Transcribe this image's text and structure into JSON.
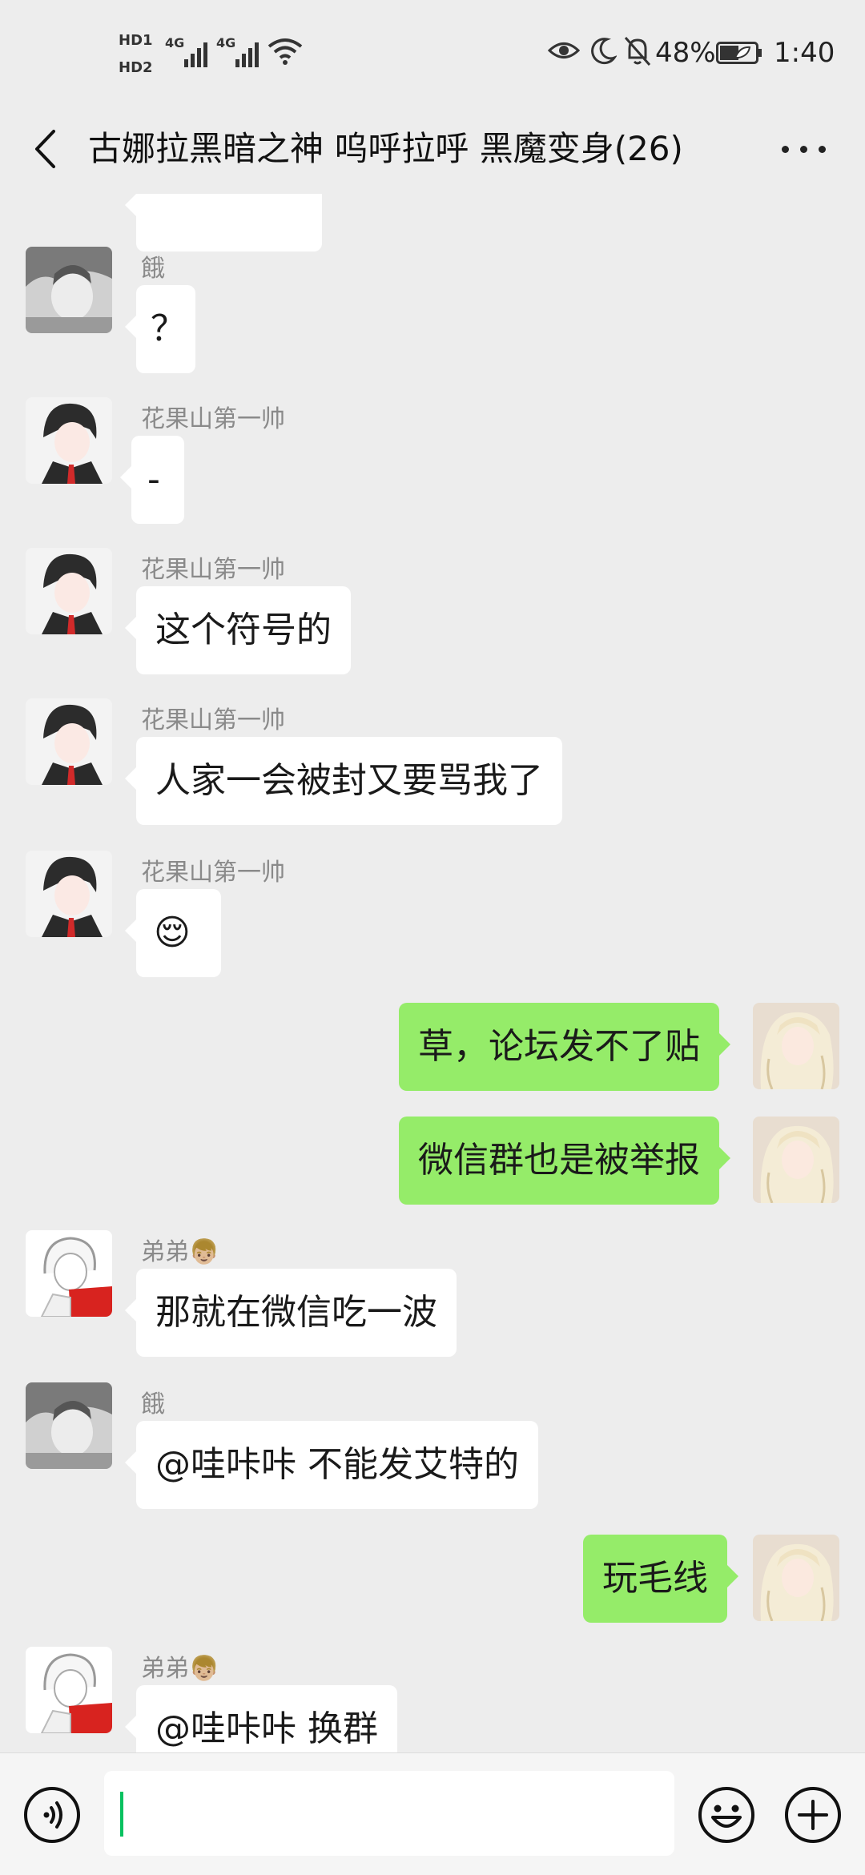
{
  "status_bar": {
    "sim1": "HD1",
    "sim2": "HD2",
    "net1": "4G",
    "net2": "4G",
    "battery": "48%",
    "time": "1:40",
    "icons": [
      "eye-icon",
      "moon-icon",
      "bell-off-icon",
      "battery-icon",
      "wifi-icon"
    ]
  },
  "header": {
    "title": "古娜拉黑暗之神 呜呼拉呼 黑魔变身(26)",
    "back_icon": "chevron-left-icon",
    "more_icon": "more-dots-icon"
  },
  "messages": [
    {
      "dir": "in",
      "sender": "",
      "text": "",
      "partial": true
    },
    {
      "dir": "in",
      "sender": "餓",
      "text": "？",
      "avatar": "gray-sketch"
    },
    {
      "dir": "in",
      "sender": "花果山第一帅",
      "text": "-",
      "avatar": "dark-hair-suit"
    },
    {
      "dir": "in",
      "sender": "花果山第一帅",
      "text": "这个符号的",
      "avatar": "dark-hair-suit"
    },
    {
      "dir": "in",
      "sender": "花果山第一帅",
      "text": "人家一会被封又要骂我了",
      "avatar": "dark-hair-suit"
    },
    {
      "dir": "in",
      "sender": "花果山第一帅",
      "text": "😌",
      "avatar": "dark-hair-suit"
    },
    {
      "dir": "out",
      "text": "草，论坛发不了贴",
      "avatar": "blonde-hair"
    },
    {
      "dir": "out",
      "text": "微信群也是被举报",
      "avatar": "blonde-hair"
    },
    {
      "dir": "in",
      "sender": "弟弟👦🏼",
      "text": "那就在微信吃一波",
      "avatar": "red-jacket"
    },
    {
      "dir": "in",
      "sender": "餓",
      "text": "@哇咔咔  不能发艾特的",
      "avatar": "gray-sketch"
    },
    {
      "dir": "out",
      "text": "玩毛线",
      "avatar": "blonde-hair"
    },
    {
      "dir": "in",
      "sender": "弟弟👦🏼",
      "text": "@哇咔咔  换群",
      "avatar": "red-jacket"
    }
  ],
  "input_bar": {
    "voice_icon": "voice-icon",
    "input_value": "",
    "emoji_icon": "emoji-icon",
    "plus_icon": "plus-icon"
  },
  "colors": {
    "background": "#ededed",
    "outgoing_bubble": "#95ec69",
    "incoming_bubble": "#ffffff",
    "cursor": "#07c160"
  }
}
